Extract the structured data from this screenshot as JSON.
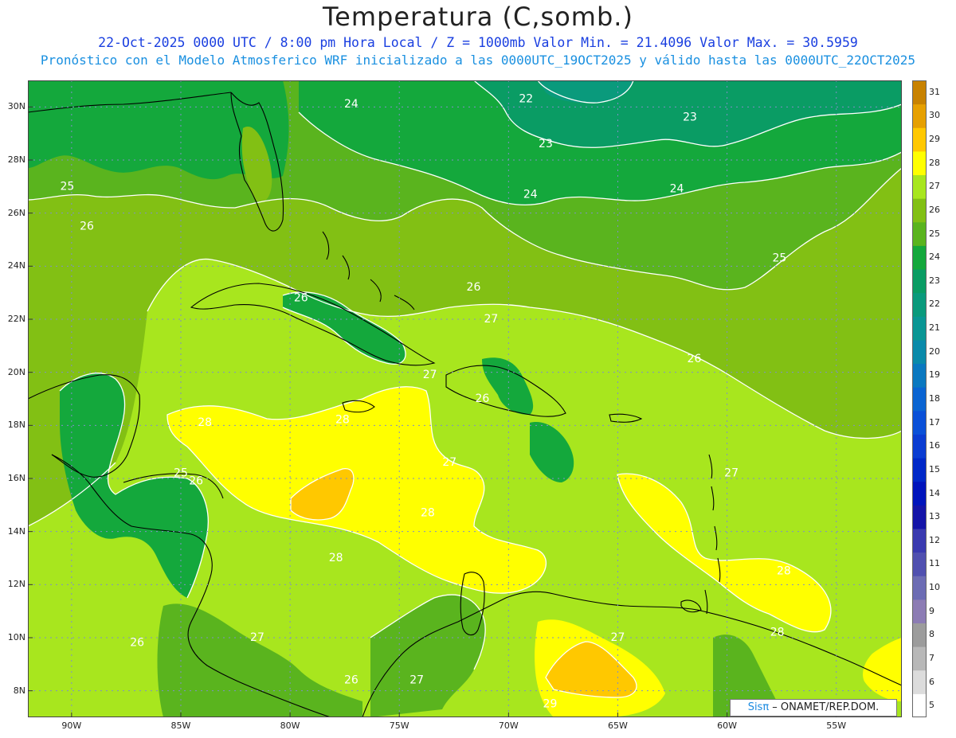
{
  "title": "Temperatura (C,somb.)",
  "subtitle_1": "22-Oct-2025  0000 UTC / 8:00 pm Hora Local / Z = 1000mb   Valor Min. = 21.4096  Valor Max. = 30.5959",
  "subtitle_2": "Pronóstico con el Modelo Atmosferico WRF inicializado a las 0000UTC_19OCT2025 y válido hasta las  0000UTC_22OCT2025",
  "credit": {
    "brand": "Sisπ",
    "text": " – ONAMET/REP.DOM."
  },
  "map": {
    "lon_range": [
      -92,
      -52
    ],
    "lat_range": [
      7,
      31
    ],
    "lat_ticks": [
      {
        "v": 8,
        "t": "8N"
      },
      {
        "v": 10,
        "t": "10N"
      },
      {
        "v": 12,
        "t": "12N"
      },
      {
        "v": 14,
        "t": "14N"
      },
      {
        "v": 16,
        "t": "16N"
      },
      {
        "v": 18,
        "t": "18N"
      },
      {
        "v": 20,
        "t": "20N"
      },
      {
        "v": 22,
        "t": "22N"
      },
      {
        "v": 24,
        "t": "24N"
      },
      {
        "v": 26,
        "t": "26N"
      },
      {
        "v": 28,
        "t": "28N"
      },
      {
        "v": 30,
        "t": "30N"
      }
    ],
    "lon_ticks": [
      {
        "v": -90,
        "t": "90W"
      },
      {
        "v": -85,
        "t": "85W"
      },
      {
        "v": -80,
        "t": "80W"
      },
      {
        "v": -75,
        "t": "75W"
      },
      {
        "v": -70,
        "t": "70W"
      },
      {
        "v": -65,
        "t": "65W"
      },
      {
        "v": -60,
        "t": "60W"
      },
      {
        "v": -55,
        "t": "55W"
      }
    ],
    "contour_labels": [
      {
        "lon": -77.2,
        "lat": 30.1,
        "t": "24"
      },
      {
        "lon": -69.2,
        "lat": 30.3,
        "t": "22"
      },
      {
        "lon": -68.3,
        "lat": 28.6,
        "t": "23"
      },
      {
        "lon": -61.7,
        "lat": 29.6,
        "t": "23"
      },
      {
        "lon": -90.2,
        "lat": 27.0,
        "t": "25"
      },
      {
        "lon": -89.3,
        "lat": 25.5,
        "t": "26"
      },
      {
        "lon": -69.0,
        "lat": 26.7,
        "t": "24"
      },
      {
        "lon": -62.3,
        "lat": 26.9,
        "t": "24"
      },
      {
        "lon": -79.5,
        "lat": 22.8,
        "t": "26"
      },
      {
        "lon": -71.6,
        "lat": 23.2,
        "t": "26"
      },
      {
        "lon": -57.6,
        "lat": 24.3,
        "t": "25"
      },
      {
        "lon": -70.8,
        "lat": 22.0,
        "t": "27"
      },
      {
        "lon": -61.5,
        "lat": 20.5,
        "t": "26"
      },
      {
        "lon": -73.6,
        "lat": 19.9,
        "t": "27"
      },
      {
        "lon": -71.2,
        "lat": 19.0,
        "t": "26"
      },
      {
        "lon": -83.9,
        "lat": 18.1,
        "t": "28"
      },
      {
        "lon": -77.6,
        "lat": 18.2,
        "t": "28"
      },
      {
        "lon": -72.7,
        "lat": 16.6,
        "t": "27"
      },
      {
        "lon": -85.0,
        "lat": 16.2,
        "t": "25"
      },
      {
        "lon": -84.3,
        "lat": 15.9,
        "t": "26"
      },
      {
        "lon": -59.8,
        "lat": 16.2,
        "t": "27"
      },
      {
        "lon": -73.7,
        "lat": 14.7,
        "t": "28"
      },
      {
        "lon": -77.9,
        "lat": 13.0,
        "t": "28"
      },
      {
        "lon": -57.4,
        "lat": 12.5,
        "t": "28"
      },
      {
        "lon": -87.0,
        "lat": 9.8,
        "t": "26"
      },
      {
        "lon": -81.5,
        "lat": 10.0,
        "t": "27"
      },
      {
        "lon": -65.0,
        "lat": 10.0,
        "t": "27"
      },
      {
        "lon": -57.7,
        "lat": 10.2,
        "t": "28"
      },
      {
        "lon": -77.2,
        "lat": 8.4,
        "t": "26"
      },
      {
        "lon": -74.2,
        "lat": 8.4,
        "t": "27"
      },
      {
        "lon": -68.1,
        "lat": 7.5,
        "t": "29"
      }
    ]
  },
  "colorbar": {
    "levels": [
      "5",
      "6",
      "7",
      "8",
      "9",
      "10",
      "11",
      "12",
      "13",
      "14",
      "15",
      "16",
      "17",
      "18",
      "19",
      "20",
      "21",
      "22",
      "23",
      "24",
      "25",
      "26",
      "27",
      "28",
      "29",
      "30",
      "31"
    ],
    "colors": [
      "#ffffff",
      "#dcdcdc",
      "#b8b8b8",
      "#9c9c9c",
      "#8c7cb4",
      "#6c6cb4",
      "#5050b0",
      "#3a3ab0",
      "#1414a8",
      "#0014bc",
      "#0028c8",
      "#0a3cd2",
      "#0a50d8",
      "#0a64d2",
      "#0a78c0",
      "#0a8aaa",
      "#0a9694",
      "#0a9a7c",
      "#0a9c64",
      "#14a83c",
      "#5ab41e",
      "#82c014",
      "#a8e61e",
      "#ffff00",
      "#ffc800",
      "#e6a000",
      "#c88200"
    ]
  }
}
